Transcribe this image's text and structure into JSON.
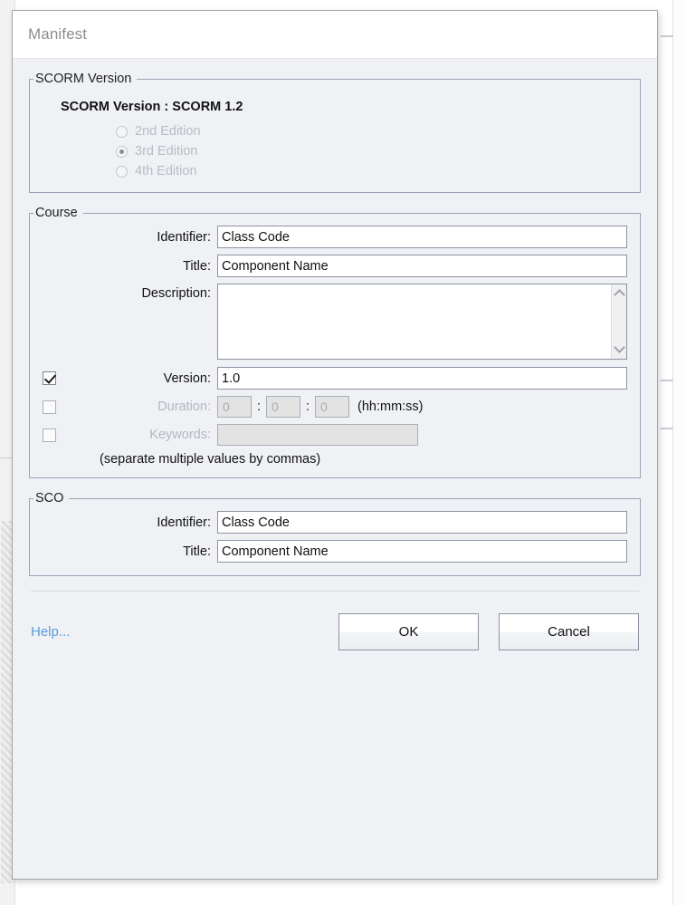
{
  "dialog": {
    "title": "Manifest"
  },
  "scorm_version_group": {
    "legend": "SCORM Version",
    "version_line": "SCORM Version : SCORM 1.2",
    "editions": [
      {
        "label": "2nd Edition",
        "selected": false,
        "disabled": true
      },
      {
        "label": "3rd Edition",
        "selected": true,
        "disabled": true
      },
      {
        "label": "4th Edition",
        "selected": false,
        "disabled": true
      }
    ]
  },
  "course_group": {
    "legend": "Course",
    "identifier": {
      "label": "Identifier:",
      "value": "Class Code"
    },
    "title": {
      "label": "Title:",
      "value": "Component Name"
    },
    "description": {
      "label": "Description:",
      "value": ""
    },
    "version": {
      "label": "Version:",
      "value": "1.0",
      "checked": true
    },
    "duration": {
      "label": "Duration:",
      "checked": false,
      "hours": "0",
      "minutes": "0",
      "seconds": "0",
      "separator": ":",
      "format_hint": "(hh:mm:ss)"
    },
    "keywords": {
      "label": "Keywords:",
      "value": "",
      "checked": false
    },
    "keywords_note": "(separate multiple values by commas)"
  },
  "sco_group": {
    "legend": "SCO",
    "identifier": {
      "label": "Identifier:",
      "value": "Class Code"
    },
    "title": {
      "label": "Title:",
      "value": "Component Name"
    }
  },
  "footer": {
    "help_label": "Help...",
    "ok_label": "OK",
    "cancel_label": "Cancel"
  },
  "colors": {
    "dialog_background": "#eff1f5",
    "titlebar_background": "#ffffff",
    "title_text": "#8d8d8d",
    "group_border": "#9aa3b4",
    "field_border": "#8d93a1",
    "disabled_text": "#b4b8c0",
    "help_link": "#5b9bd5",
    "text": "#121215"
  }
}
